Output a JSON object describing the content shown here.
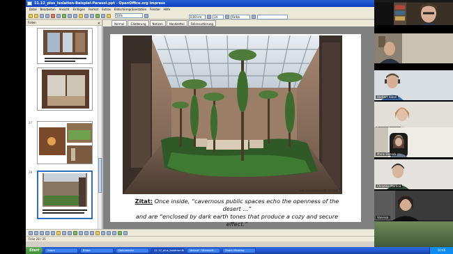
{
  "window": {
    "title": "11.12_plus_Isolation-Beispiel-Parasol.ppt - OpenOffice.org Impress"
  },
  "menu": [
    "Datei",
    "Bearbeiten",
    "Ansicht",
    "Einfügen",
    "Format",
    "Extras",
    "Bildschirmpräsentation",
    "Fenster",
    "Hilfe"
  ],
  "toolbar": {
    "zoom": "50%",
    "font_size": "14",
    "position": "0,00 cm",
    "color_label": "Farbe"
  },
  "slides_panel": {
    "title": "Folien",
    "close": "×",
    "slides": [
      {
        "num": ""
      },
      {
        "num": ""
      },
      {
        "num": "27"
      },
      {
        "num": "28"
      }
    ]
  },
  "view_tabs": [
    "Normal",
    "Gliederung",
    "Notizen",
    "Handzettel",
    "Foliensortierung"
  ],
  "slide": {
    "caption_label": "Zitat:",
    "caption_line1": "Once inside, “cavernous public spaces echo the openness of the desert ...”",
    "caption_line2": "and are “enclosed by dark earth tones that produce a cozy and secure effect.”",
    "photo_credit": "http://archdaily.com/22.07.2020"
  },
  "status": {
    "text": "Folie 28 / 35"
  },
  "taskbar": {
    "start": "Start",
    "tasks": [
      "Zoom",
      "Bilder",
      "Dokumente",
      "11.12_plus_Isolation-Beisp...",
      "Verlauf - Microsoft...",
      "Zoom Meeting"
    ],
    "clock": "10:46"
  },
  "participants": [
    {
      "name": ""
    },
    {
      "name": ""
    },
    {
      "name": "Herbert Höbel"
    },
    {
      "name": "Patricia Bergner"
    },
    {
      "name": "Marie Daneck"
    },
    {
      "name": "Christine Martina"
    },
    {
      "name": "Vanessa"
    }
  ]
}
